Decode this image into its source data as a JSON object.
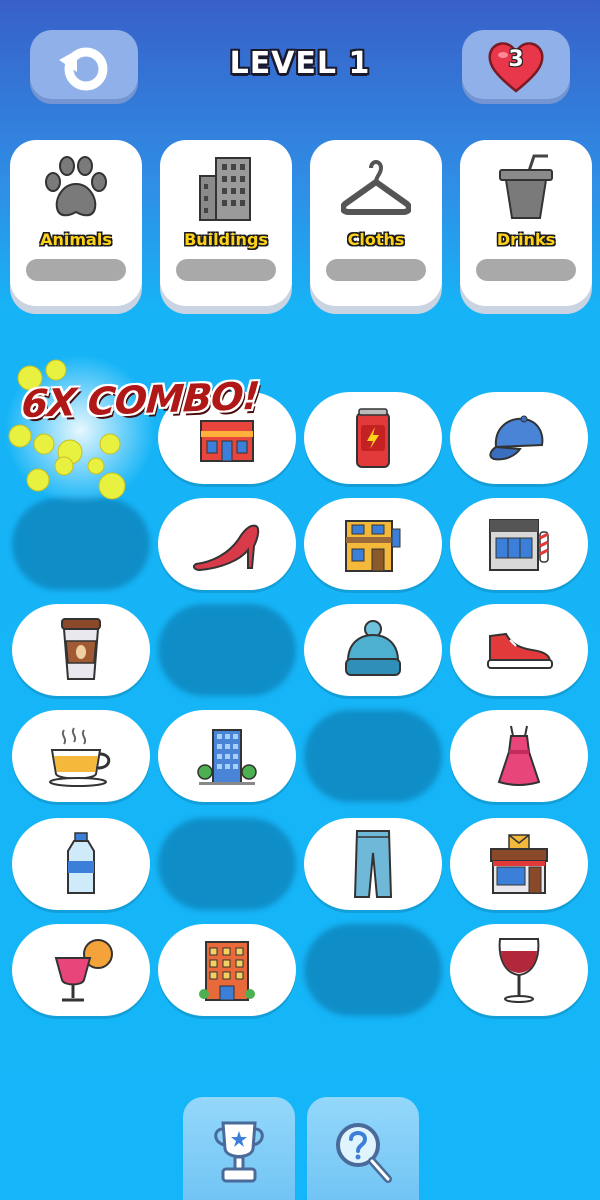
{
  "header": {
    "title": "LEVEL 1",
    "restart_icon": "restart-icon",
    "lives": "3",
    "lives_icon": "heart-icon"
  },
  "categories": [
    {
      "label": "Animals",
      "icon": "paw-icon"
    },
    {
      "label": "Buildings",
      "icon": "building-icon"
    },
    {
      "label": "Cloths",
      "icon": "hanger-icon"
    },
    {
      "label": "Drinks",
      "icon": "cup-icon"
    }
  ],
  "combo": {
    "text": "6X COMBO!"
  },
  "grid": {
    "rows": [
      [
        "combo-burst",
        "shop-building",
        "soda-can",
        "baseball-cap"
      ],
      [
        "empty",
        "high-heel",
        "yellow-store",
        "barber-shop"
      ],
      [
        "coffee-cup",
        "empty",
        "beanie-hat",
        "sneaker"
      ],
      [
        "tea-cup",
        "office-tower",
        "empty",
        "pink-dress"
      ],
      [
        "water-bottle",
        "empty",
        "jeans",
        "post-office"
      ],
      [
        "cocktail",
        "apartment-building",
        "empty",
        "wine-glass"
      ]
    ]
  },
  "bottom": {
    "trophy_icon": "trophy-icon",
    "hint_icon": "magnifier-hint-icon"
  },
  "colors": {
    "accent_yellow": "#ffd21a",
    "combo_red": "#b01818",
    "heart_red": "#e8364a",
    "tile_white": "#ffffff",
    "empty_slot": "#0f8dc7"
  }
}
